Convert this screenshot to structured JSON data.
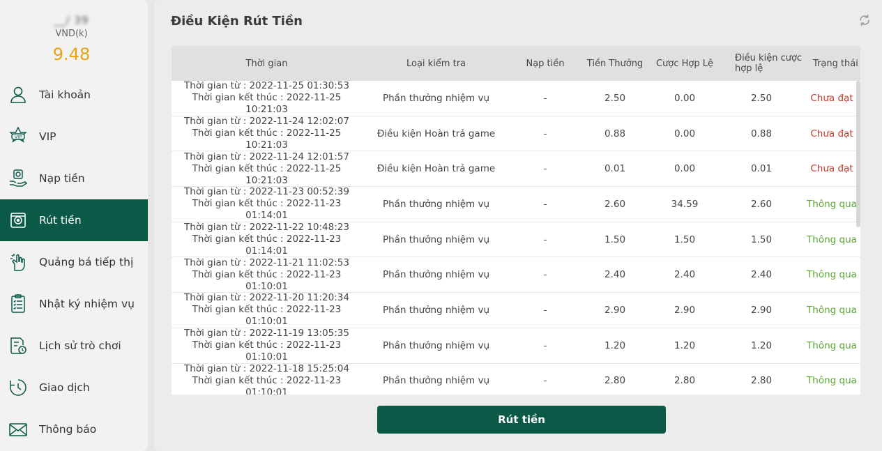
{
  "user": {
    "name": "__/ 39",
    "currency": "VND(k)",
    "balance": "9.48"
  },
  "menu": [
    {
      "label": "Tài khoản",
      "icon": "user-icon",
      "active": false
    },
    {
      "label": "VIP",
      "icon": "vip-badge-icon",
      "active": false
    },
    {
      "label": "Nạp tiền",
      "icon": "deposit-icon",
      "active": false
    },
    {
      "label": "Rút tiền",
      "icon": "withdraw-icon",
      "active": true
    },
    {
      "label": "Quảng bá tiếp thị",
      "icon": "promotion-hand-icon",
      "active": false
    },
    {
      "label": "Nhật ký nhiệm vụ",
      "icon": "task-clipboard-icon",
      "active": false
    },
    {
      "label": "Lịch sử trò chơi",
      "icon": "game-history-icon",
      "active": false
    },
    {
      "label": "Giao dịch",
      "icon": "transaction-clock-icon",
      "active": false
    },
    {
      "label": "Thông báo",
      "icon": "mail-icon",
      "active": false
    }
  ],
  "page": {
    "title": "Điều Kiện Rút Tiền",
    "refresh_icon": "refresh-icon"
  },
  "table": {
    "headers": {
      "time": "Thời gian",
      "check_type": "Loại kiểm tra",
      "deposit": "Nạp tiền",
      "bonus": "Tiền Thưởng",
      "valid_bet": "Cược Hợp Lệ",
      "bet_condition": "Điều kiện cược hợp lệ",
      "status": "Trạng thái"
    },
    "rows": [
      {
        "start": "Thời gian từ : 2022-11-25 01:30:53",
        "end": "Thời gian kết thúc : 2022-11-25 10:21:03",
        "type": "Phần thưởng nhiệm vụ",
        "deposit": "-",
        "bonus": "2.50",
        "valid_bet": "0.00",
        "condition": "2.50",
        "status": "Chưa đạt",
        "passed": false
      },
      {
        "start": "Thời gian từ : 2022-11-24 12:02:07",
        "end": "Thời gian kết thúc : 2022-11-25 10:21:03",
        "type": "Điều kiện Hoàn trả game",
        "deposit": "-",
        "bonus": "0.88",
        "valid_bet": "0.00",
        "condition": "0.88",
        "status": "Chưa đạt",
        "passed": false
      },
      {
        "start": "Thời gian từ : 2022-11-24 12:01:57",
        "end": "Thời gian kết thúc : 2022-11-25 10:21:03",
        "type": "Điều kiện Hoàn trả game",
        "deposit": "-",
        "bonus": "0.01",
        "valid_bet": "0.00",
        "condition": "0.01",
        "status": "Chưa đạt",
        "passed": false
      },
      {
        "start": "Thời gian từ : 2022-11-23 00:52:39",
        "end": "Thời gian kết thúc : 2022-11-23 01:14:01",
        "type": "Phần thưởng nhiệm vụ",
        "deposit": "-",
        "bonus": "2.60",
        "valid_bet": "34.59",
        "condition": "2.60",
        "status": "Thông qua",
        "passed": true
      },
      {
        "start": "Thời gian từ : 2022-11-22 10:48:23",
        "end": "Thời gian kết thúc : 2022-11-23 01:14:01",
        "type": "Phần thưởng nhiệm vụ",
        "deposit": "-",
        "bonus": "1.50",
        "valid_bet": "1.50",
        "condition": "1.50",
        "status": "Thông qua",
        "passed": true
      },
      {
        "start": "Thời gian từ : 2022-11-21 11:02:53",
        "end": "Thời gian kết thúc : 2022-11-23 01:10:01",
        "type": "Phần thưởng nhiệm vụ",
        "deposit": "-",
        "bonus": "2.40",
        "valid_bet": "2.40",
        "condition": "2.40",
        "status": "Thông qua",
        "passed": true
      },
      {
        "start": "Thời gian từ : 2022-11-20 11:20:34",
        "end": "Thời gian kết thúc : 2022-11-23 01:10:01",
        "type": "Phần thưởng nhiệm vụ",
        "deposit": "-",
        "bonus": "2.90",
        "valid_bet": "2.90",
        "condition": "2.90",
        "status": "Thông qua",
        "passed": true
      },
      {
        "start": "Thời gian từ : 2022-11-19 13:05:35",
        "end": "Thời gian kết thúc : 2022-11-23 01:10:01",
        "type": "Phần thưởng nhiệm vụ",
        "deposit": "-",
        "bonus": "1.20",
        "valid_bet": "1.20",
        "condition": "1.20",
        "status": "Thông qua",
        "passed": true
      },
      {
        "start": "Thời gian từ : 2022-11-18 15:25:04",
        "end": "Thời gian kết thúc : 2022-11-23 01:10:01",
        "type": "Phần thưởng nhiệm vụ",
        "deposit": "-",
        "bonus": "2.80",
        "valid_bet": "2.80",
        "condition": "2.80",
        "status": "Thông qua",
        "passed": true
      }
    ]
  },
  "actions": {
    "withdraw_button": "Rút tiền"
  },
  "colors": {
    "primary": "#0b5a47",
    "balance": "#e8a317",
    "status_fail": "#c0392b",
    "status_pass": "#5aa832"
  }
}
